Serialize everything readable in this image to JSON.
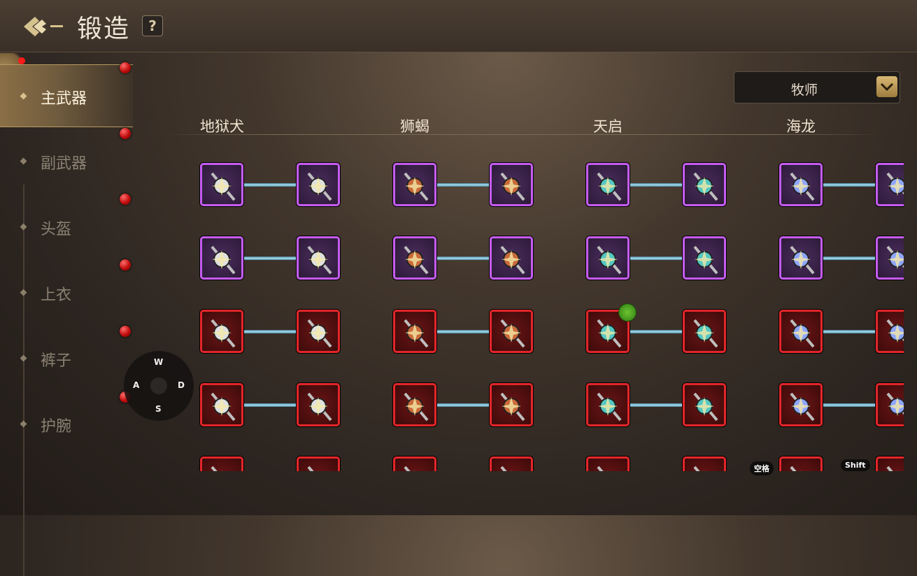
{
  "header": {
    "title": "锻造",
    "help_label": "?"
  },
  "sidebar": {
    "tabs": [
      {
        "label": "主武器",
        "active": true
      },
      {
        "label": "副武器",
        "active": false
      },
      {
        "label": "头盔",
        "active": false
      },
      {
        "label": "上衣",
        "active": false
      },
      {
        "label": "裤子",
        "active": false
      },
      {
        "label": "护腕",
        "active": false
      }
    ]
  },
  "class_select": {
    "value": "牧师"
  },
  "sets": [
    "地狱犬",
    "狮蝎",
    "天启",
    "海龙"
  ],
  "grid": {
    "rows": [
      "purple",
      "purple",
      "red",
      "red",
      "red"
    ],
    "set_icons": [
      "mace-spiked",
      "gauntlet",
      "lantern",
      "hammer"
    ]
  },
  "joystick": {
    "up": "W",
    "left": "A",
    "right": "D",
    "down": "S"
  },
  "key_hints": {
    "space": "空格",
    "shift": "Shift"
  },
  "colors": {
    "epic": "#c55cf0",
    "legendary": "#e2262a",
    "connector": "#a8e2f5"
  }
}
